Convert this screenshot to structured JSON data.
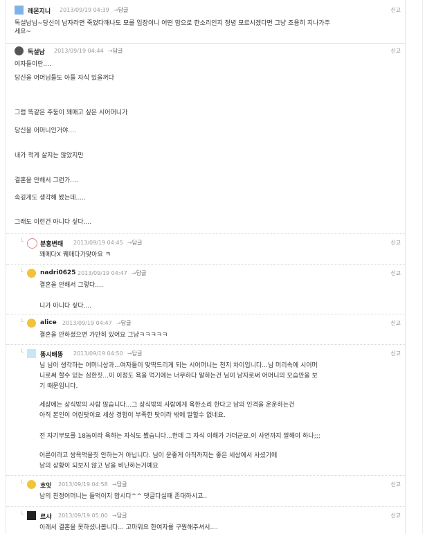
{
  "comments": [
    {
      "nick": "레몬지니",
      "date": "2013/09/19 04:39",
      "reply_label": "답글",
      "report_label": "신고",
      "avatar_icon": "lemon-avatar-icon",
      "lines": [
        "독설남님~당신이 남자라면 죽었다깨나도 모를 입장이니 어떤 맘으로 한소리인지 정녕 모르시겠다면 그냥 조용히 지나가주",
        "세요~"
      ]
    },
    {
      "nick": "독설남",
      "date": "2013/09/19 04:44",
      "reply_label": "답글",
      "report_label": "신고",
      "avatar_icon": "skull-avatar-icon",
      "lines": [
        "여자들이란....",
        "당신을 어머님들도 아들 자식 있을꺼다",
        "그럼 똑같은 주둥이 꽤매고 싶은 시어머니가",
        "당신을 어머니인거야....",
        "내가 적게 살지는 않았지만",
        "결혼을 안해서 그런가....",
        "속깊게도 생각해 봤는데.....",
        "그래도 이런건 아니다 싶다...."
      ]
    },
    {
      "nick": "분홍변태",
      "date": "2013/09/19 04:45",
      "reply_label": "답글",
      "report_label": "신고",
      "avatar_icon": "swirl-avatar-icon",
      "lines": [
        "꽤메다X 꿰매다가맞아요 ㅋ"
      ]
    },
    {
      "nick": "nadri0625",
      "date": "2013/09/19 04:47",
      "reply_label": "답글",
      "report_label": "신고",
      "avatar_icon": "smiley-avatar-icon",
      "lines": [
        "결혼을 안해서 그렇다....",
        "니가 아니다 싶다...."
      ]
    },
    {
      "nick": "alice",
      "date": "2013/09/19 04:47",
      "reply_label": "답글",
      "report_label": "신고",
      "avatar_icon": "smiley-avatar-icon",
      "lines": [
        "결혼을 안하셨으면 가만히 있어요 그냥ㅋㅋㅋㅋㅋ"
      ]
    },
    {
      "nick": "똥시배똥",
      "date": "2013/09/19 04:50",
      "reply_label": "답글",
      "report_label": "신고",
      "avatar_icon": "flower-avatar-icon",
      "lines": [
        "님 님이 생각하는 어머니상과...여자들이 맞딱드리게 되는 시어머니는 천지 차이입니다...님 머리속에 시어머",
        "니로써 할수 있는 심한짓...이 이정도 욕을 먹기에는 너무하다 말하는건 님이 남자로써 어머니의 모습만을 보",
        "기 때문입니다.",
        "세상에는 상식밖의 사람 많습니다...그 상식밖의 사람에게 욕한소리 한다고 남의 인격을 운운하는건",
        "아직 본인이 어린탓이요 세상 경험이 부족한 탓이라 밖에 말할수 없네요.",
        "전 자기부모를 18놈이라 욕하는 자식도 봤습니다...헌데 그 자식 이해가 가더군요.이 사연까지 말해야 하나;;;",
        "어른이라고 쌍욕먹을짓 안하는거 아닙니다. 님이 운좋게 아직까지는 좋은 세상에서 사셨기에",
        "남의 상황이 되보지 않고 남을 비난하는거예요"
      ]
    },
    {
      "nick": "호잇",
      "date": "2013/09/19 04:58",
      "reply_label": "답글",
      "report_label": "신고",
      "avatar_icon": "smiley-avatar-icon",
      "lines": [
        "남의 친정어머니는 들먹이지 맙시다^^ 댓글다실때 존대하시고.."
      ]
    },
    {
      "nick": "르샤",
      "date": "2013/09/19 05:00",
      "reply_label": "답글",
      "report_label": "신고",
      "avatar_icon": "butterfly-avatar-icon",
      "lines": [
        "이래서 결혼을 못하셨나봅니다... 고마워요 한여자를 구원해주셔서...."
      ]
    }
  ]
}
